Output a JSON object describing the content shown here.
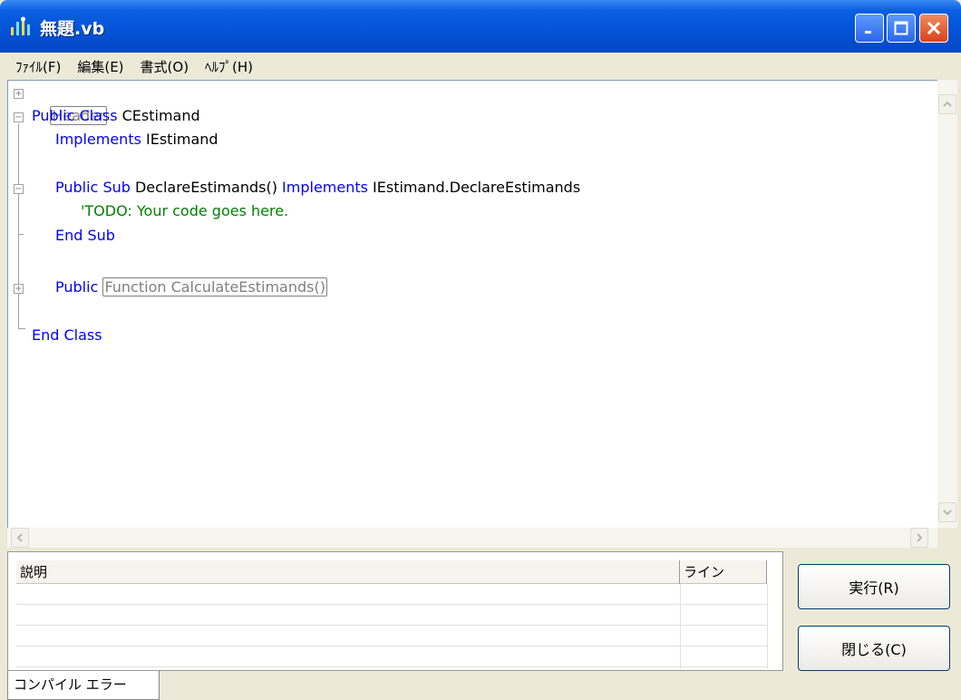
{
  "window": {
    "title": "無題.vb",
    "app_icon": "vb-app-icon",
    "controls": [
      "minimize-icon",
      "maximize-icon",
      "close-icon"
    ]
  },
  "menu": [
    {
      "label": "ﾌｧｲﾙ(F)"
    },
    {
      "label": "編集(E)"
    },
    {
      "label": "書式(O)"
    },
    {
      "label": "ﾍﾙﾌﾟ(H)"
    }
  ],
  "editor": {
    "line1_collapsed": "Header",
    "line2_kw": "Public Class ",
    "line2_tx": "CEstimand",
    "line3_kw": "Implements ",
    "line3_tx": "IEstimand",
    "line5_kw1": "Public Sub ",
    "line5_tx1": "DeclareEstimands() ",
    "line5_kw2": "Implements ",
    "line5_tx2": "IEstimand.DeclareEstimands",
    "line6_comment": "'TODO: Your code goes here.",
    "line7_kw": "End Sub",
    "line9_kw": "Public ",
    "line9_collapsed": "Function CalculateEstimands()",
    "line11_kw": "End Class"
  },
  "errors_grid": {
    "columns": [
      "説明",
      "ライン"
    ],
    "rows": []
  },
  "tabs": [
    {
      "label": "コンパイル エラー"
    }
  ],
  "buttons": {
    "run": "実行(R)",
    "close": "閉じる(C)"
  },
  "colors": {
    "keyword": "#0000ff",
    "comment": "#008000",
    "titlebar": "#0453d6"
  }
}
